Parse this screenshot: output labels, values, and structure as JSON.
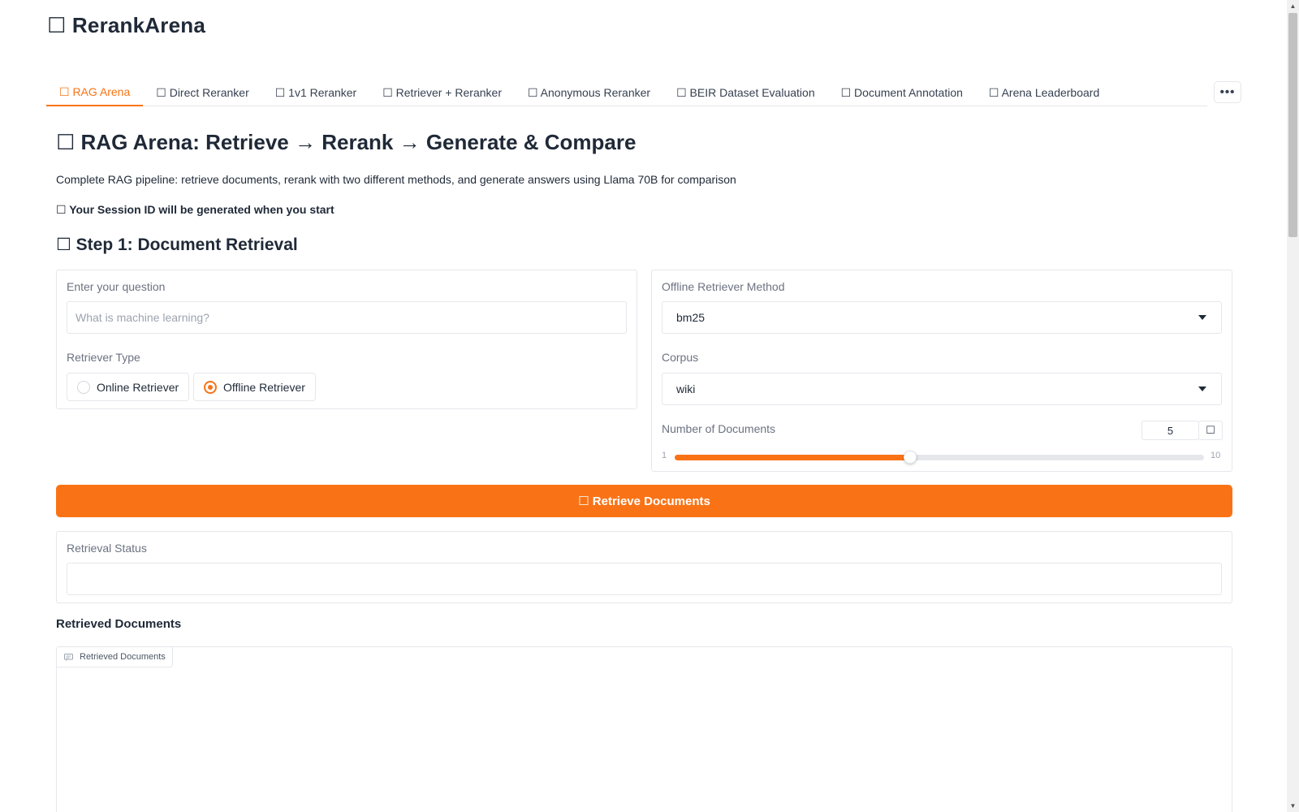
{
  "app": {
    "title": "☐ RerankArena"
  },
  "tabs": [
    {
      "label": "☐ RAG Arena",
      "active": true
    },
    {
      "label": "☐ Direct Reranker"
    },
    {
      "label": "☐ 1v1 Reranker"
    },
    {
      "label": "☐ Retriever + Reranker"
    },
    {
      "label": "☐ Anonymous Reranker"
    },
    {
      "label": "☐ BEIR Dataset Evaluation"
    },
    {
      "label": "☐ Document Annotation"
    },
    {
      "label": "☐ Arena Leaderboard"
    }
  ],
  "more_label": "•••",
  "main": {
    "heading": "☐ RAG Arena: Retrieve → Rerank → Generate & Compare",
    "description": "Complete RAG pipeline: retrieve documents, rerank with two different methods, and generate answers using Llama 70B for comparison",
    "session_note": "☐ Your Session ID will be generated when you start",
    "step1_heading": "☐ Step 1: Document Retrieval"
  },
  "question": {
    "label": "Enter your question",
    "value": "",
    "placeholder": "What is machine learning?"
  },
  "retriever_type": {
    "label": "Retriever Type",
    "options": [
      {
        "label": "Online Retriever",
        "selected": false
      },
      {
        "label": "Offline Retriever",
        "selected": true
      }
    ]
  },
  "offline_method": {
    "label": "Offline Retriever Method",
    "value": "bm25"
  },
  "corpus": {
    "label": "Corpus",
    "value": "wiki"
  },
  "num_docs": {
    "label": "Number of Documents",
    "value": "5",
    "min": "1",
    "max": "10",
    "reset_label": "☐"
  },
  "retrieve_button": "☐ Retrieve Documents",
  "retrieval_status": {
    "label": "Retrieval Status",
    "value": ""
  },
  "retrieved": {
    "heading": "Retrieved Documents",
    "tag_label": "Retrieved Documents"
  },
  "colors": {
    "accent": "#f97316",
    "border": "#e5e7eb",
    "text": "#1f2937",
    "muted": "#6b7280"
  }
}
